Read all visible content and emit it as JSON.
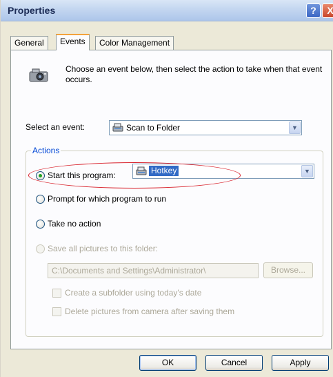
{
  "window": {
    "title": "Properties",
    "help_glyph": "?",
    "close_glyph": "X"
  },
  "tabs": [
    {
      "label": "General",
      "active": false
    },
    {
      "label": "Events",
      "active": true
    },
    {
      "label": "Color Management",
      "active": false
    }
  ],
  "intro": {
    "icon": "camera-icon",
    "text": "Choose an event below, then select the action to take when that event occurs."
  },
  "event": {
    "label": "Select an event:",
    "selected": "Scan to Folder",
    "icon": "scanner-icon"
  },
  "actions": {
    "group_title": "Actions",
    "start_program": {
      "label": "Start this program:",
      "checked": true
    },
    "program_combo": {
      "selected": "Hotkey",
      "icon": "scanner-icon"
    },
    "prompt": {
      "label": "Prompt for which program to run",
      "checked": false
    },
    "no_action": {
      "label": "Take no action",
      "checked": false
    },
    "save_all": {
      "label": "Save all pictures to this folder:",
      "checked": false,
      "disabled": true
    },
    "folder_path": "C:\\Documents and Settings\\Administrator\\",
    "browse_label": "Browse...",
    "subfolder_label": "Create a subfolder using today's date",
    "delete_label": "Delete pictures from camera after saving them"
  },
  "buttons": {
    "ok": "OK",
    "cancel": "Cancel",
    "apply": "Apply"
  },
  "colors": {
    "highlight_ellipse": "#d8202a",
    "selected_radio": "#21a121"
  }
}
